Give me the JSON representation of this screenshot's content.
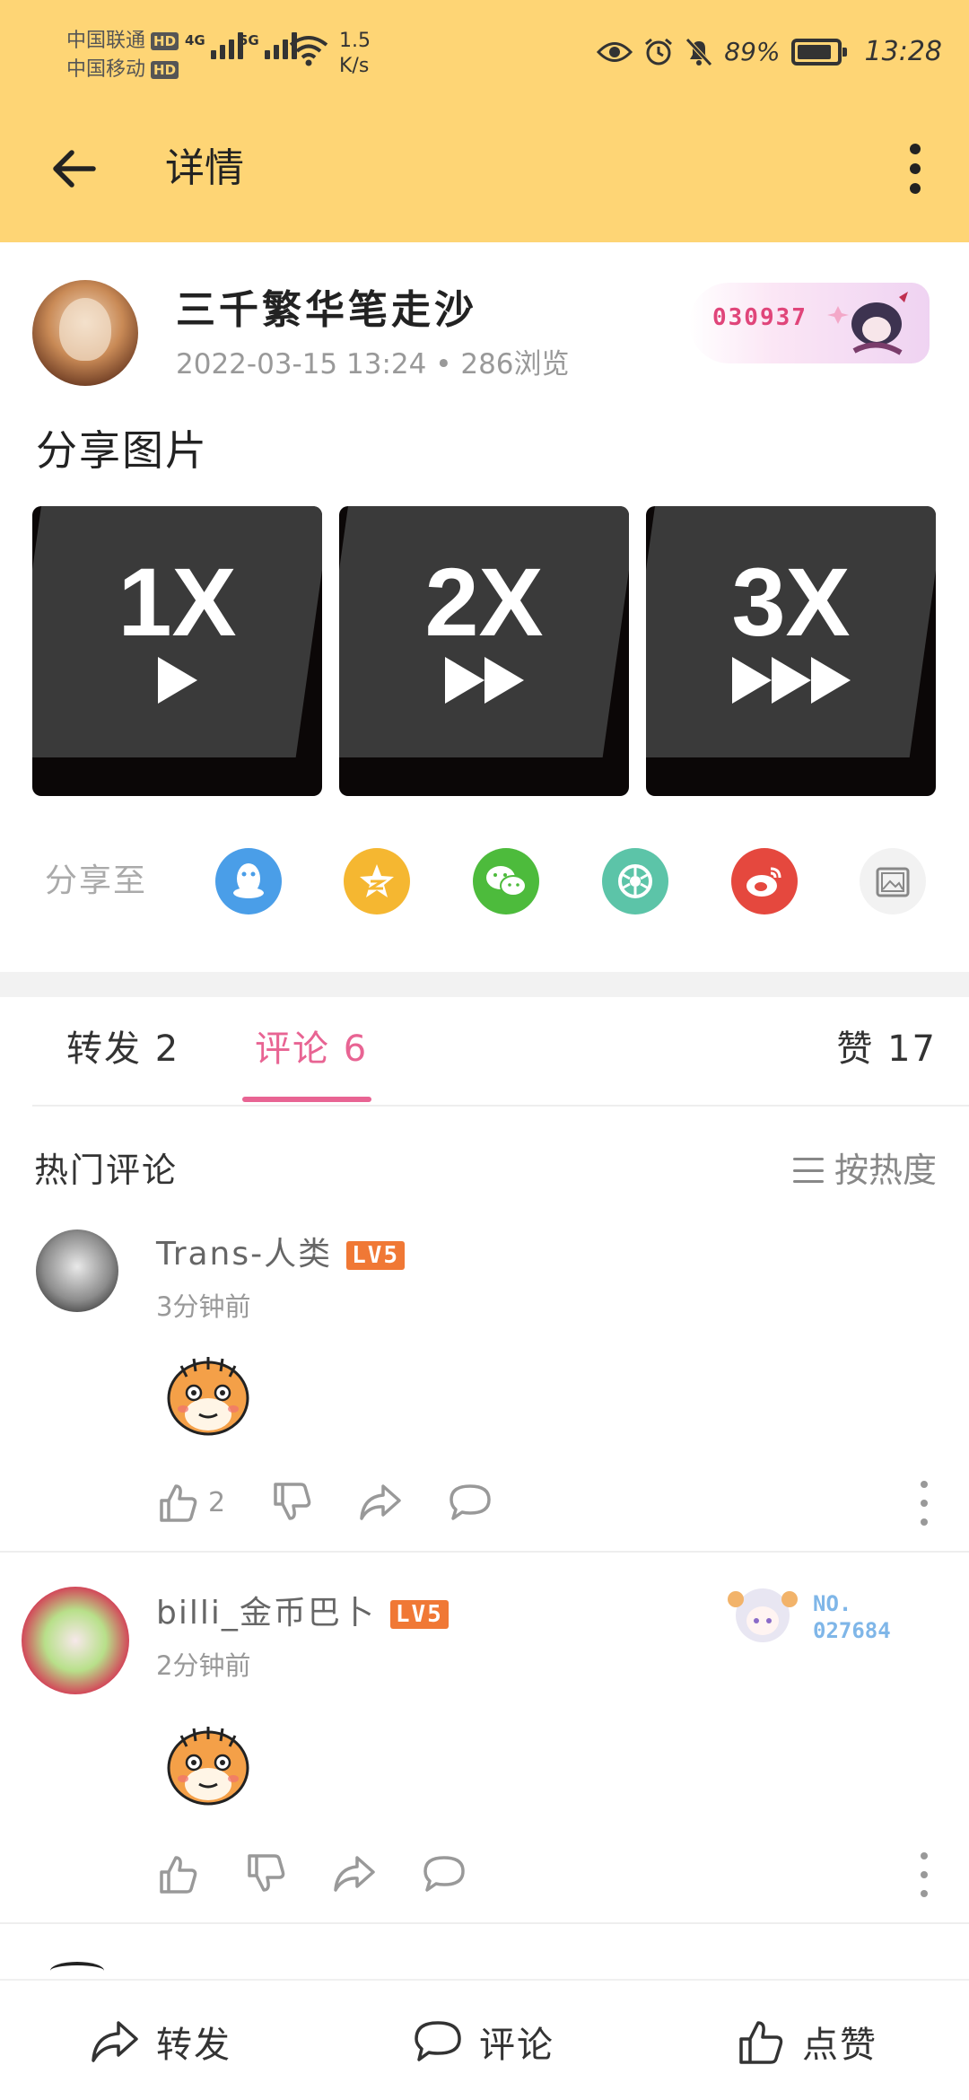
{
  "status_bar": {
    "carrier1": "中国联通",
    "carrier2": "中国移动",
    "hd": "HD",
    "net1": "4G",
    "net2": "5G",
    "speed_value": "1.5",
    "speed_unit": "K/s",
    "battery_pct": "89%",
    "time": "13:28"
  },
  "header": {
    "title": "详情"
  },
  "post": {
    "username": "三千繁华笔走沙",
    "meta": "2022-03-15 13:24 • 286浏览",
    "badge_number": "030937",
    "text": "分享图片",
    "images": [
      {
        "speed": "1X",
        "arrows": 1
      },
      {
        "speed": "2X",
        "arrows": 2
      },
      {
        "speed": "3X",
        "arrows": 3
      }
    ]
  },
  "share": {
    "label": "分享至",
    "targets": [
      {
        "icon": "qq-icon",
        "color": "#4A9EE8"
      },
      {
        "icon": "qzone-icon",
        "color": "#F5B731"
      },
      {
        "icon": "wechat-icon",
        "color": "#4DBB3C"
      },
      {
        "icon": "moments-icon",
        "color": "#5CC4A8"
      },
      {
        "icon": "weibo-icon",
        "color": "#E5483E"
      },
      {
        "icon": "save-image-icon",
        "color": "#F2F2F2"
      }
    ]
  },
  "tabs": {
    "forward": "转发 2",
    "comment": "评论 6",
    "like": "赞 17"
  },
  "comments_section": {
    "title": "热门评论",
    "sort_label": "按热度"
  },
  "comments": [
    {
      "name": "Trans-人类",
      "level": "LV5",
      "time": "3分钟前",
      "likes": "2"
    },
    {
      "name": "billi_金币巴卜",
      "level": "LV5",
      "time": "2分钟前",
      "likes": "",
      "badge": "NO.\n027684"
    }
  ],
  "bottom_bar": {
    "forward": "转发",
    "comment": "评论",
    "like": "点赞"
  },
  "colors": {
    "header_bg": "#FED575",
    "accent_pink": "#E86493",
    "level_badge": "#F07835"
  }
}
